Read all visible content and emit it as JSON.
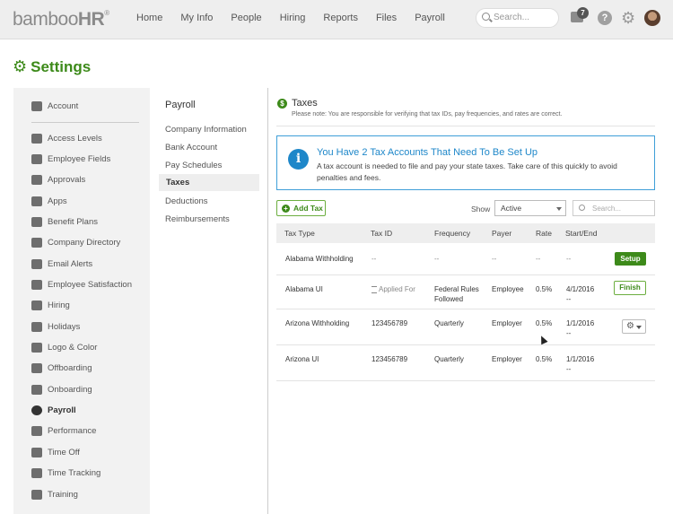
{
  "topnav": {
    "logo_bamboo": "bamboo",
    "logo_hr": "HR",
    "logo_reg": "®",
    "items": [
      "Home",
      "My Info",
      "People",
      "Hiring",
      "Reports",
      "Files",
      "Payroll"
    ],
    "search_placeholder": "Search...",
    "inbox_count": "7",
    "help_glyph": "?"
  },
  "page": {
    "title": "Settings"
  },
  "sidebar": {
    "items": [
      {
        "label": "Account",
        "icon": "wrench-icon"
      },
      {
        "label": "Access Levels",
        "icon": "lock-icon"
      },
      {
        "label": "Employee Fields",
        "icon": "fields-icon"
      },
      {
        "label": "Approvals",
        "icon": "thumbs-up-icon"
      },
      {
        "label": "Apps",
        "icon": "puzzle-icon"
      },
      {
        "label": "Benefit Plans",
        "icon": "heart-icon"
      },
      {
        "label": "Company Directory",
        "icon": "directory-icon"
      },
      {
        "label": "Email Alerts",
        "icon": "envelope-icon"
      },
      {
        "label": "Employee Satisfaction",
        "icon": "smile-icon"
      },
      {
        "label": "Hiring",
        "icon": "megaphone-icon"
      },
      {
        "label": "Holidays",
        "icon": "gift-icon"
      },
      {
        "label": "Logo & Color",
        "icon": "palette-icon"
      },
      {
        "label": "Offboarding",
        "icon": "calendar-out-icon"
      },
      {
        "label": "Onboarding",
        "icon": "calendar-in-icon"
      },
      {
        "label": "Payroll",
        "icon": "dollar-icon"
      },
      {
        "label": "Performance",
        "icon": "performance-icon"
      },
      {
        "label": "Time Off",
        "icon": "time-off-icon"
      },
      {
        "label": "Time Tracking",
        "icon": "stopwatch-icon"
      },
      {
        "label": "Training",
        "icon": "graduation-cap-icon"
      }
    ],
    "active": "Payroll"
  },
  "payroll_menu": {
    "title": "Payroll",
    "items": [
      "Company Information",
      "Bank Account",
      "Pay Schedules",
      "Taxes",
      "Deductions",
      "Reimbursements"
    ],
    "active": "Taxes"
  },
  "taxes": {
    "title": "Taxes",
    "note": "Please note: You are responsible for verifying that tax IDs, pay frequencies, and rates are correct.",
    "alert_title": "You Have 2 Tax Accounts That Need To Be Set Up",
    "alert_body": "A tax account is needed to file and pay your state taxes. Take care of this quickly to avoid penalties and fees.",
    "add_button": "Add Tax",
    "show_label": "Show",
    "show_value": "Active",
    "search_placeholder": "Search...",
    "columns": [
      "Tax Type",
      "Tax ID",
      "Frequency",
      "Payer",
      "Rate",
      "Start/End"
    ],
    "rows": [
      {
        "type": "Alabama Withholding",
        "id": "--",
        "freq": "--",
        "payer": "--",
        "rate": "--",
        "start": "--",
        "end": "",
        "action": "Setup"
      },
      {
        "type": "Alabama UI",
        "id": "Applied For",
        "freq": "Federal Rules Followed",
        "payer": "Employee",
        "rate": "0.5%",
        "start": "4/1/2016",
        "end": "--",
        "action": "Finish"
      },
      {
        "type": "Arizona Withholding",
        "id": "123456789",
        "freq": "Quarterly",
        "payer": "Employer",
        "rate": "0.5%",
        "start": "1/1/2016",
        "end": "--",
        "action": "gear"
      },
      {
        "type": "Arizona UI",
        "id": "123456789",
        "freq": "Quarterly",
        "payer": "Employer",
        "rate": "0.5%",
        "start": "1/1/2016",
        "end": "--",
        "action": ""
      }
    ]
  }
}
